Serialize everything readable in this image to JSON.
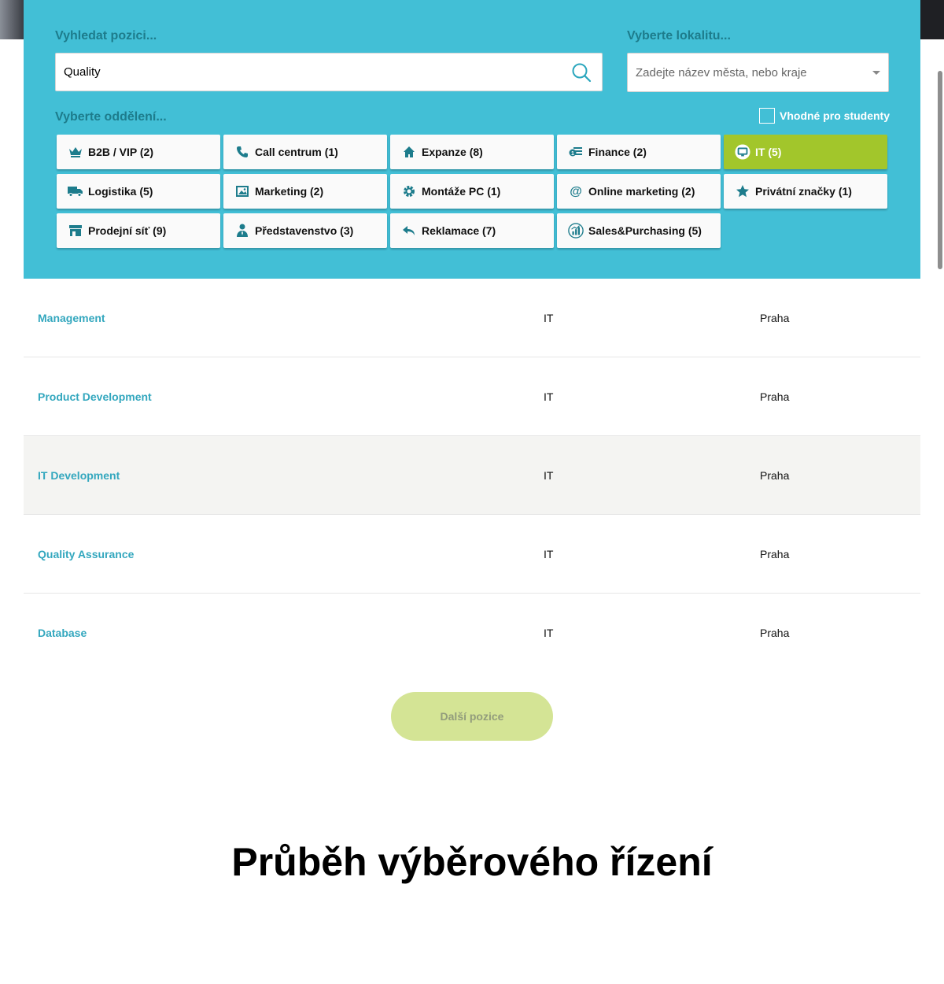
{
  "filters": {
    "search_label": "Vyhledat pozici...",
    "search_value": "Quality",
    "location_label": "Vyberte lokalitu...",
    "location_placeholder": "Zadejte název města, nebo kraje",
    "department_label": "Vyberte oddělení...",
    "students_label": "Vhodné pro studenty",
    "students_checked": false
  },
  "departments": [
    {
      "label": "B2B / VIP (2)",
      "icon": "crown-icon",
      "active": false
    },
    {
      "label": "Call centrum (1)",
      "icon": "phone-icon",
      "active": false
    },
    {
      "label": "Expanze (8)",
      "icon": "home-icon",
      "active": false
    },
    {
      "label": "Finance (2)",
      "icon": "money-icon",
      "active": false
    },
    {
      "label": "IT (5)",
      "icon": "monitor-icon",
      "active": true
    },
    {
      "label": "Logistika (5)",
      "icon": "truck-icon",
      "active": false
    },
    {
      "label": "Marketing (2)",
      "icon": "image-icon",
      "active": false
    },
    {
      "label": "Montáže PC (1)",
      "icon": "gear-icon",
      "active": false
    },
    {
      "label": "Online marketing (2)",
      "icon": "at-icon",
      "active": false
    },
    {
      "label": "Privátní značky (1)",
      "icon": "star-icon",
      "active": false
    },
    {
      "label": "Prodejní síť (9)",
      "icon": "store-icon",
      "active": false
    },
    {
      "label": "Představenstvo (3)",
      "icon": "person-icon",
      "active": false
    },
    {
      "label": "Reklamace (7)",
      "icon": "reply-icon",
      "active": false
    },
    {
      "label": "Sales&Purchasing (5)",
      "icon": "chart-icon",
      "active": false
    }
  ],
  "jobs": [
    {
      "title": "Management",
      "department": "IT",
      "location": "Praha"
    },
    {
      "title": "Product Development",
      "department": "IT",
      "location": "Praha"
    },
    {
      "title": "IT Development",
      "department": "IT",
      "location": "Praha"
    },
    {
      "title": "Quality Assurance",
      "department": "IT",
      "location": "Praha"
    },
    {
      "title": "Database",
      "department": "IT",
      "location": "Praha"
    }
  ],
  "more_button": "Další pozice",
  "section_title": "Průběh výběrového řízení",
  "colors": {
    "panel": "#42bfd6",
    "label": "#1d7c8c",
    "active_chip": "#a2c62b",
    "job_link": "#33a7be",
    "icon": "#1d7c8c",
    "more_button": "#d4e495"
  }
}
